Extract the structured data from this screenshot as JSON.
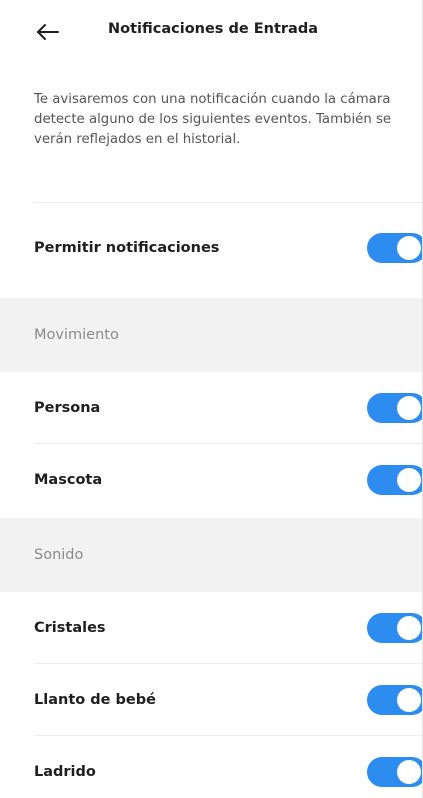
{
  "header": {
    "title": "Notificaciones de Entrada",
    "back_icon": "arrow-left-icon"
  },
  "description": "Te avisaremos con una notificación cuando la cámara detecte alguno de los siguientes eventos. También se verán reflejados en el historial.",
  "settings": {
    "allow_notifications": {
      "label": "Permitir notificaciones",
      "enabled": true
    }
  },
  "sections": {
    "movement": {
      "title": "Movimiento",
      "items": [
        {
          "label": "Persona",
          "enabled": true
        },
        {
          "label": "Mascota",
          "enabled": true
        }
      ]
    },
    "sound": {
      "title": "Sonido",
      "items": [
        {
          "label": "Cristales",
          "enabled": true
        },
        {
          "label": "Llanto de bebé",
          "enabled": true
        },
        {
          "label": "Ladrido",
          "enabled": true
        }
      ]
    }
  },
  "colors": {
    "toggle_on": "#2d8cf0",
    "section_bg": "#f2f2f2"
  }
}
